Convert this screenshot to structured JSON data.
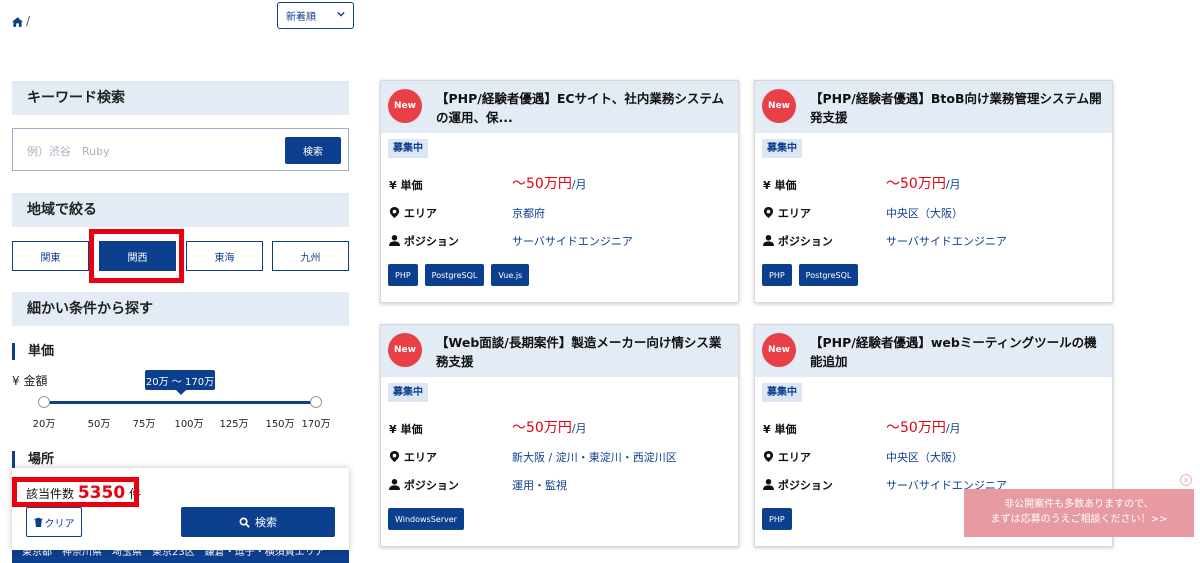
{
  "breadcrumb": {
    "separator": "/"
  },
  "sort": {
    "selected": "新着順"
  },
  "sidebar": {
    "keyword_heading": "キーワード検索",
    "keyword_placeholder": "例）渋谷　Ruby",
    "keyword_button": "検索",
    "region_heading": "地域で絞る",
    "regions": [
      "関東",
      "関西",
      "東海",
      "九州"
    ],
    "active_region": "関西",
    "detail_heading": "細かい条件から探す",
    "price_heading": "単価",
    "amount_label": "¥ 金額",
    "range_label": "20万 〜 170万",
    "range_min": 20,
    "range_max": 170,
    "ticks": [
      "20万",
      "50万",
      "75万",
      "100万",
      "125万",
      "150万",
      "170万"
    ],
    "location_heading": "場所",
    "count_label": "該当件数",
    "count_value": "5350",
    "count_unit": "件",
    "clear_button": "クリア",
    "search_button": "検索",
    "prefectures": "東京都　神奈川県　埼玉県　東京23区　鎌倉・逗子・横須賀エリア"
  },
  "cards": [
    {
      "badge": "New",
      "title": "【PHP/経験者優遇】ECサイト、社内業務システムの運用、保...",
      "status": "募集中",
      "price": "〜50万円",
      "price_unit": "/月",
      "area": "京都府",
      "position": "サーバサイドエンジニア",
      "tags": [
        "PHP",
        "PostgreSQL",
        "Vue.js"
      ]
    },
    {
      "badge": "New",
      "title": "【PHP/経験者優遇】BtoB向け業務管理システム開発支援",
      "status": "募集中",
      "price": "〜50万円",
      "price_unit": "/月",
      "area": "中央区（大阪）",
      "position": "サーバサイドエンジニア",
      "tags": [
        "PHP",
        "PostgreSQL"
      ]
    },
    {
      "badge": "New",
      "title": "【Web面談/長期案件】製造メーカー向け情シス業務支援",
      "status": "募集中",
      "price": "〜50万円",
      "price_unit": "/月",
      "area": "新大阪 / 淀川・東淀川・西淀川区",
      "position": "運用・監視",
      "tags": [
        "WindowsServer"
      ]
    },
    {
      "badge": "New",
      "title": "【PHP/経験者優遇】webミーティングツールの機能追加",
      "status": "募集中",
      "price": "〜50万円",
      "price_unit": "/月",
      "area": "中央区（大阪）",
      "position": "サーバサイドエンジニア",
      "tags": [
        "PHP"
      ]
    }
  ],
  "labels": {
    "price": "単価",
    "area": "エリア",
    "position": "ポジション",
    "yen": "¥"
  },
  "promo": {
    "line1": "非公開案件も多数ありますので、",
    "line2": "まずは応募のうえご相談ください！>>"
  },
  "colors": {
    "primary": "#0d3f8f",
    "accent_red": "#e60012",
    "new_badge": "#e94048",
    "header_bg": "#e3ebf4",
    "promo_bg": "#e79aa2"
  }
}
